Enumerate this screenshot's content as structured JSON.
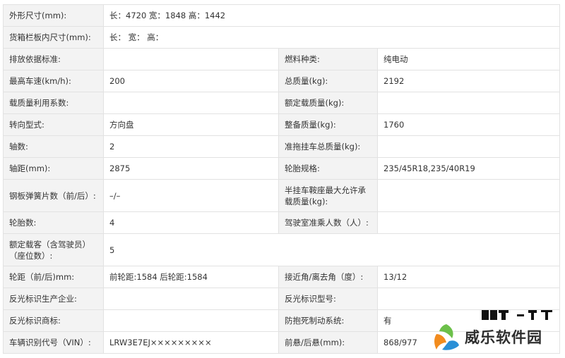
{
  "rows": [
    {
      "l1": "外形尺寸(mm):",
      "v1": "长：4720 宽：1848 高：1442"
    },
    {
      "l1": "货箱栏板内尺寸(mm):",
      "v1": "长： 宽： 高："
    },
    {
      "l1": "排放依据标准:",
      "v1": "",
      "l2": "燃料种类:",
      "v2": "纯电动"
    },
    {
      "l1": "最高车速(km/h):",
      "v1": "200",
      "l2": "总质量(kg):",
      "v2": "2192"
    },
    {
      "l1": "载质量利用系数:",
      "v1": "",
      "l2": "额定载质量(kg):",
      "v2": ""
    },
    {
      "l1": "转向型式:",
      "v1": "方向盘",
      "l2": "整备质量(kg):",
      "v2": "1760"
    },
    {
      "l1": "轴数:",
      "v1": "2",
      "l2": "准拖挂车总质量(kg):",
      "v2": ""
    },
    {
      "l1": "轴距(mm):",
      "v1": "2875",
      "l2": "轮胎规格:",
      "v2": "235/45R18,235/40R19"
    },
    {
      "l1": "钢板弹簧片数（前/后）:",
      "v1": "–/–",
      "l2": "半挂车鞍座最大允许承载质量(kg):",
      "v2": ""
    },
    {
      "l1": "轮胎数:",
      "v1": "4",
      "l2": "驾驶室准乘人数（人）:",
      "v2": ""
    },
    {
      "l1": "额定载客（含驾驶员）（座位数）:",
      "v1": "5"
    },
    {
      "l1": "轮距（前/后)mm:",
      "v1": "前轮距:1584 后轮距:1584",
      "l2": "接近角/离去角（度）:",
      "v2": "13/12"
    },
    {
      "l1": "反光标识生产企业:",
      "v1": "",
      "l2": "反光标识型号:",
      "v2": ""
    },
    {
      "l1": "反光标识商标:",
      "v1": "",
      "l2": "防抱死制动系统:",
      "v2": "有"
    },
    {
      "l1": "车辆识别代号（VIN）:",
      "v1": "LRW3E7EJ×××××××××",
      "l2": "前悬/后悬(mm):",
      "v2": "868/977"
    }
  ],
  "watermark": {
    "text": "威乐软件园",
    "logo_icon": "leaf-swirl-logo-icon",
    "colors": {
      "green": "#6cc04a",
      "orange": "#f28c1e",
      "blue": "#2a8fd6"
    }
  }
}
